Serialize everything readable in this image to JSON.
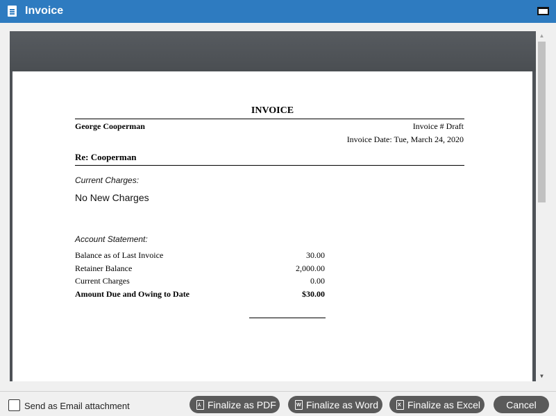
{
  "window": {
    "title": "Invoice",
    "title_icon": "document-icon",
    "maximize_icon": "maximize-icon"
  },
  "invoice": {
    "heading": "INVOICE",
    "client_name": "George Cooperman",
    "invoice_number": "Invoice # Draft",
    "invoice_date": "Invoice Date: Tue, March 24, 2020",
    "re": "Re: Cooperman",
    "current_charges_label": "Current Charges:",
    "no_new_charges": "No New Charges",
    "account_statement_label": "Account Statement:",
    "statement_rows": [
      {
        "label": "Balance as of Last Invoice",
        "value": "30.00"
      },
      {
        "label": "Retainer Balance",
        "value": "2,000.00"
      },
      {
        "label": "Current Charges",
        "value": "0.00"
      },
      {
        "label": "Amount Due and Owing to Date",
        "value": "$30.00"
      }
    ]
  },
  "footer": {
    "email_checkbox_label": "Send as Email attachment",
    "email_checked": false,
    "buttons": [
      {
        "label": "Finalize as PDF",
        "icon": "pdf-file-icon",
        "glyph": "⅄"
      },
      {
        "label": "Finalize as Word",
        "icon": "word-file-icon",
        "glyph": "W"
      },
      {
        "label": "Finalize as Excel",
        "icon": "excel-file-icon",
        "glyph": "X"
      },
      {
        "label": "Cancel"
      }
    ]
  },
  "colors": {
    "titlebar": "#2e7bc0",
    "button": "#5a5a5a",
    "viewer_bg": "#4e5257"
  }
}
